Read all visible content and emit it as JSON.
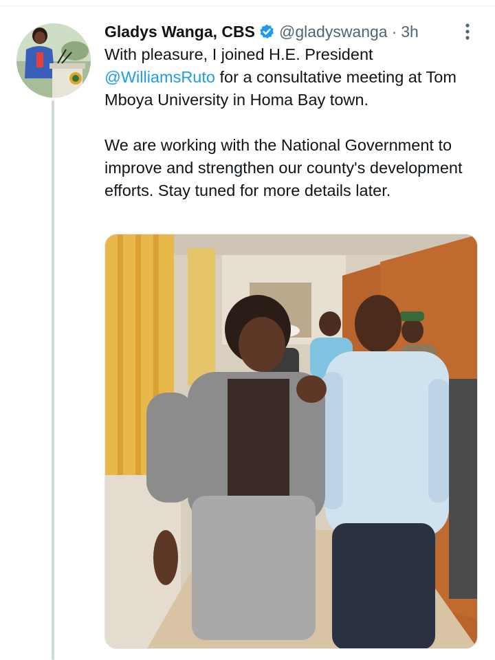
{
  "tweet": {
    "author": {
      "display_name": "Gladys Wanga, CBS",
      "verified": true,
      "handle": "@gladyswanga",
      "avatar_icon": "profile-photo-speaker-at-podium"
    },
    "separator": "·",
    "time": "3h",
    "text": {
      "p1_before": "With pleasure, I joined H.E. President ",
      "mention": "@WilliamsRuto",
      "p1_after": " for a consultative meeting at Tom Mboya University in Homa Bay town.",
      "p2": "We are working with the National Government to improve and strengthen our county's development efforts. Stay tuned for more details later."
    },
    "media": {
      "type": "photo",
      "icon": "photo-two-people-walking-in-corridor"
    },
    "more_icon": "more-vertical-icon"
  },
  "colors": {
    "accent": "#1d9bf0",
    "text_primary": "#0f1419",
    "text_secondary": "#536471",
    "thread_line": "#cfd9de"
  }
}
